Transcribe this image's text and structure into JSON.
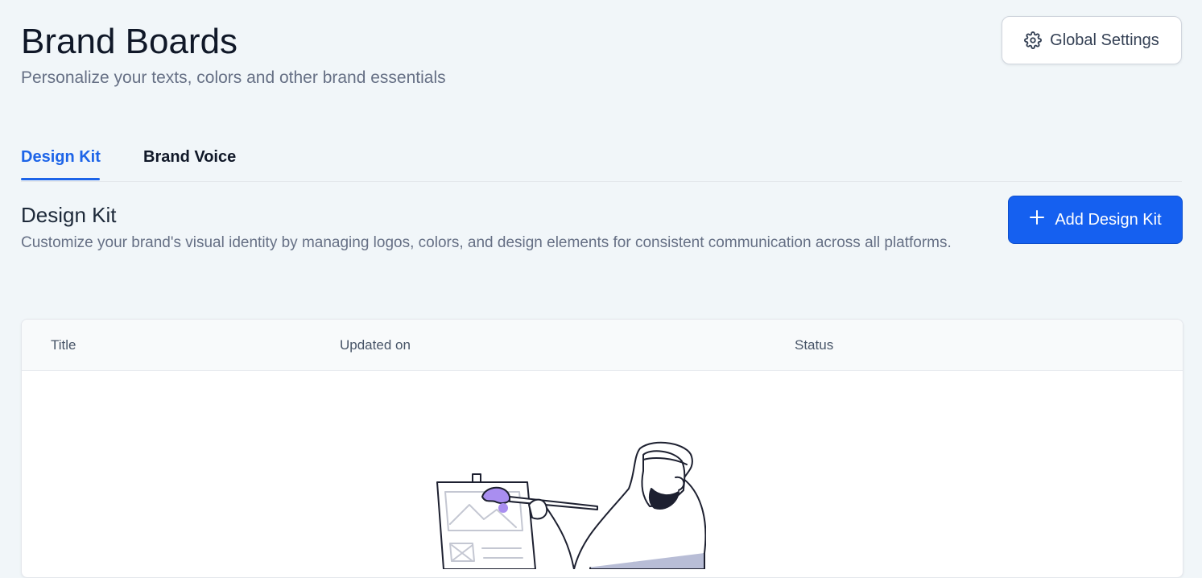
{
  "header": {
    "title": "Brand Boards",
    "subtitle": "Personalize your texts, colors and other brand essentials",
    "settings_button": {
      "label": "Global Settings",
      "icon": "gear-icon"
    }
  },
  "tabs": [
    {
      "label": "Design Kit",
      "active": true
    },
    {
      "label": "Brand Voice",
      "active": false
    }
  ],
  "section": {
    "title": "Design Kit",
    "description": "Customize your brand's visual identity by managing logos, colors, and design elements for consistent communication across all platforms.",
    "add_button": {
      "label": "Add Design Kit",
      "icon": "plus-icon"
    }
  },
  "table": {
    "columns": [
      "Title",
      "Updated on",
      "Status"
    ],
    "rows": [],
    "empty_state_illustration": "artist-painting-illustration"
  },
  "colors": {
    "accent": "#1d64e8",
    "primary_button": "#1560f0",
    "background": "#f1f6f9",
    "illustration_purple": "#a98ef0",
    "illustration_lavender": "#b8bdd6"
  }
}
